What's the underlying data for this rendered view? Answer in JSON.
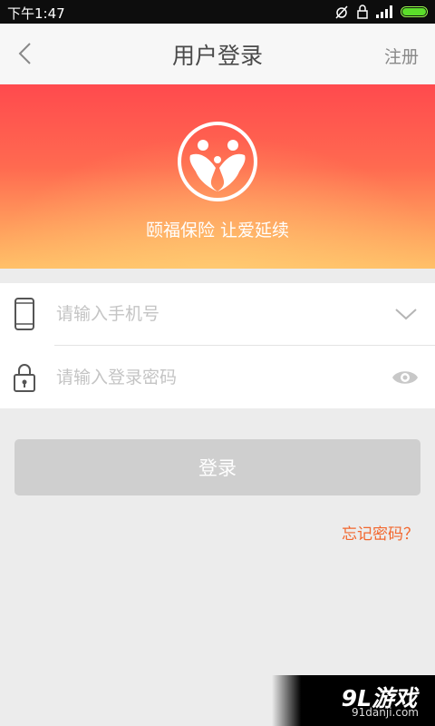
{
  "status_bar": {
    "time": "下午1:47",
    "icons": [
      "signal-icon",
      "alarm-off-icon",
      "lock-icon",
      "wifi-icon",
      "battery-icon"
    ],
    "battery_color": "#5bde2a"
  },
  "navbar": {
    "title": "用户登录",
    "back_icon": "chevron-left-icon",
    "register_label": "注册"
  },
  "banner": {
    "logo_icon": "family-heart-logo",
    "slogan": "颐福保险 让爱延续",
    "gradient_colors": [
      "#ff4a4e",
      "#ff6a50",
      "#ffc068"
    ]
  },
  "form": {
    "phone": {
      "placeholder": "请输入手机号",
      "value": "",
      "icon": "phone-icon",
      "action_icon": "chevron-down-icon"
    },
    "password": {
      "placeholder": "请输入登录密码",
      "value": "",
      "icon": "padlock-icon",
      "action_icon": "eye-icon"
    }
  },
  "login_button": {
    "label": "登录",
    "color": "#cfcfcf"
  },
  "forgot_password": {
    "label": "忘记密码？",
    "color": "#f2672e"
  },
  "watermark": {
    "logo": "9L游戏",
    "site": "91danji.com"
  }
}
